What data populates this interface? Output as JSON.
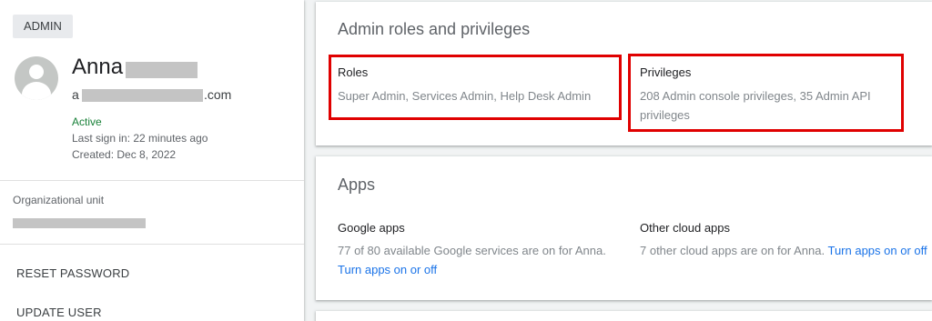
{
  "user_card": {
    "badge": "ADMIN",
    "name": "Anna",
    "email_prefix": "a",
    "email_suffix": ".com",
    "status": "Active",
    "last_sign_in": "Last sign in: 22 minutes ago",
    "created": "Created: Dec 8, 2022",
    "org_unit_label": "Organizational unit",
    "actions": [
      "RESET PASSWORD",
      "UPDATE USER"
    ]
  },
  "admin_roles": {
    "title": "Admin roles and privileges",
    "roles_label": "Roles",
    "roles_value": "Super Admin, Services Admin, Help Desk Admin",
    "privileges_label": "Privileges",
    "privileges_value": "208 Admin console privileges, 35 Admin API privileges"
  },
  "apps": {
    "title": "Apps",
    "google_label": "Google apps",
    "google_desc": "77 of 80 available Google services are on for Anna.",
    "google_link": "Turn apps on or off",
    "other_label": "Other cloud apps",
    "other_desc": "7 other cloud apps are on for Anna.",
    "other_link": "Turn apps on or off"
  },
  "colors": {
    "highlight_border": "#e00000",
    "link": "#1a73e8",
    "status_active": "#188038"
  }
}
